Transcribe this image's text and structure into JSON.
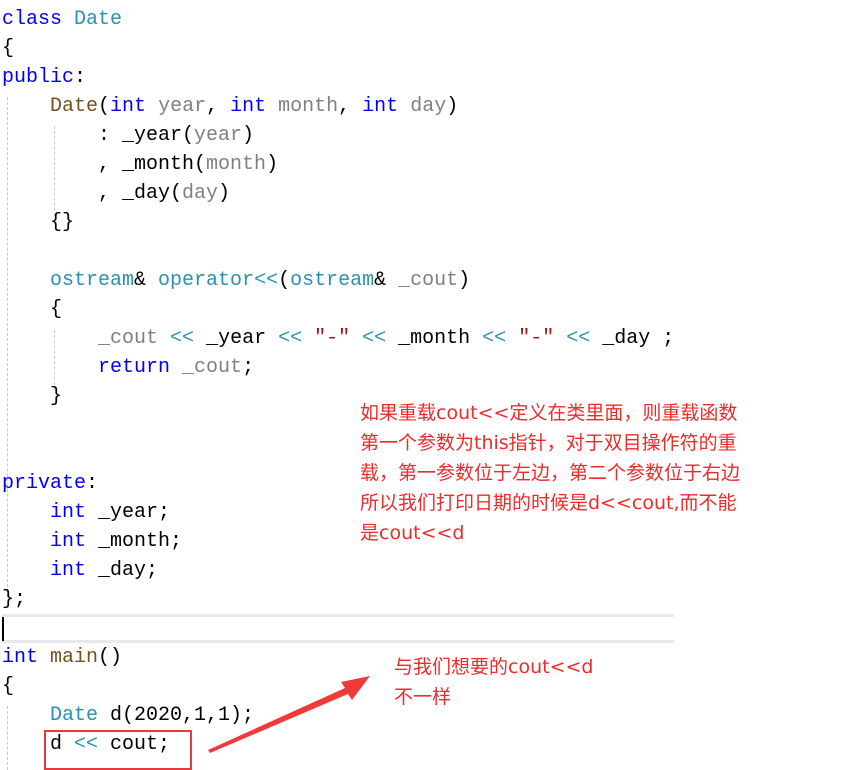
{
  "code_lines": [
    "class Date",
    "{",
    "public:",
    "    Date(int year, int month, int day)",
    "        : _year(year)",
    "        , _month(month)",
    "        , _day(day)",
    "    {}",
    "",
    "    ostream& operator<<(ostream& _cout)",
    "    {",
    "        _cout << _year << \"-\" << _month << \"-\" << _day ;",
    "        return _cout;",
    "    }",
    "",
    "",
    "private:",
    "    int _year;",
    "    int _month;",
    "    int _day;",
    "};",
    "",
    "int main()",
    "{",
    "    Date d(2020,1,1);",
    "    d << cout;"
  ],
  "annotations": {
    "note1": [
      "如果重载cout<<定义在类里面，则重载函数",
      "第一个参数为this指针，对于双目操作符的重",
      "载，第一参数位于左边，第二个参数位于右边",
      "所以我们打印日期的时候是d<<cout,而不能",
      "是cout<<d"
    ],
    "note2": [
      "与我们想要的cout<<d",
      "不一样"
    ],
    "color": "#f02a2a"
  }
}
